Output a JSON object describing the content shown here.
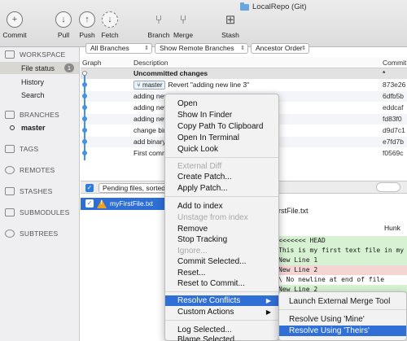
{
  "window": {
    "title": "LocalRepo (Git)"
  },
  "toolbar": [
    {
      "label": "Commit",
      "icon": "+"
    },
    {
      "label": "Pull",
      "icon": "↓"
    },
    {
      "label": "Push",
      "icon": "↑"
    },
    {
      "label": "Fetch",
      "icon": "↓"
    },
    {
      "label": "Branch",
      "icon": "⑂"
    },
    {
      "label": "Merge",
      "icon": "⑂"
    },
    {
      "label": "Stash",
      "icon": "⊞"
    }
  ],
  "sidebar": {
    "workspace": "WORKSPACE",
    "items": [
      {
        "label": "File status",
        "badge": "1"
      },
      {
        "label": "History"
      },
      {
        "label": "Search"
      }
    ],
    "branches": "BRANCHES",
    "branch": "master",
    "tags": "TAGS",
    "remotes": "REMOTES",
    "stashes": "STASHES",
    "submodules": "SUBMODULES",
    "subtrees": "SUBTREES"
  },
  "filters": {
    "branches": "All Branches",
    "remote": "Show Remote Branches",
    "order": "Ancestor Order"
  },
  "columns": {
    "graph": "Graph",
    "description": "Description",
    "commit": "Commit"
  },
  "commits": [
    {
      "desc": "Uncommitted changes",
      "hash": "*"
    },
    {
      "branch": "master",
      "desc": "Revert \"adding new line 3\"",
      "hash": "873e26"
    },
    {
      "desc": "adding new line 3",
      "hash": "6dfb5b"
    },
    {
      "desc": "adding new",
      "hash": "eddcaf"
    },
    {
      "desc": "adding new",
      "hash": "fd83f0"
    },
    {
      "desc": "change bin",
      "hash": "d9d7c1"
    },
    {
      "desc": "add binary",
      "hash": "e7fd7b"
    },
    {
      "desc": "First comm",
      "hash": "f0569c"
    }
  ],
  "pending": {
    "label": "Pending files, sorted"
  },
  "file": {
    "name": "myFirstFile.txt"
  },
  "diff": {
    "title": "irstFile.txt",
    "hunk": "Hunk",
    "lines": [
      {
        "text": "<<<<<<< HEAD",
        "kind": "green"
      },
      {
        "text": "This is my first text file in my local",
        "kind": "green"
      },
      {
        "text": "New Line 1",
        "kind": "green"
      },
      {
        "text": "New Line 2",
        "kind": "red"
      },
      {
        "text": "\\ No newline at end of file",
        "kind": "plain"
      },
      {
        "text": "New Line 2",
        "kind": "green"
      }
    ]
  },
  "menu": {
    "items": [
      {
        "label": "Open"
      },
      {
        "label": "Show In Finder"
      },
      {
        "label": "Copy Path To Clipboard"
      },
      {
        "label": "Open In Terminal"
      },
      {
        "label": "Quick Look"
      },
      {
        "label": "External Diff",
        "disabled": true
      },
      {
        "label": "Create Patch..."
      },
      {
        "label": "Apply Patch..."
      },
      {
        "label": "Add to index"
      },
      {
        "label": "Unstage from index",
        "disabled": true
      },
      {
        "label": "Remove"
      },
      {
        "label": "Stop Tracking"
      },
      {
        "label": "Ignore...",
        "disabled": true
      },
      {
        "label": "Commit Selected..."
      },
      {
        "label": "Reset..."
      },
      {
        "label": "Reset to Commit..."
      },
      {
        "label": "Resolve Conflicts",
        "submenu": true,
        "highlighted": true
      },
      {
        "label": "Custom Actions",
        "submenu": true
      },
      {
        "label": "Log Selected..."
      },
      {
        "label": "Blame Selected..."
      }
    ]
  },
  "submenu": {
    "items": [
      {
        "label": "Launch External Merge Tool"
      },
      {
        "label": "Resolve Using 'Mine'"
      },
      {
        "label": "Resolve Using 'Theirs'",
        "highlighted": true
      }
    ]
  }
}
